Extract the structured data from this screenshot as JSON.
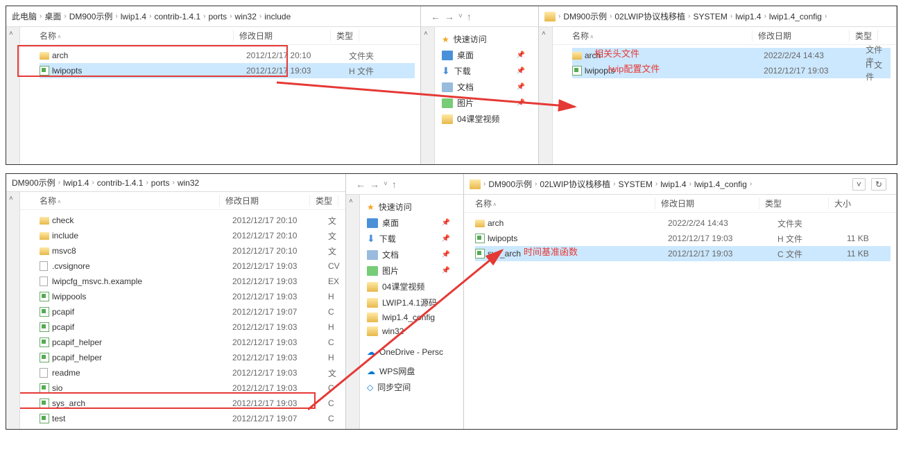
{
  "panel1": {
    "left": {
      "breadcrumb": [
        "此电脑",
        "桌面",
        "DM900示例",
        "lwip1.4",
        "contrib-1.4.1",
        "ports",
        "win32",
        "include"
      ],
      "cols": {
        "name": "名称",
        "date": "修改日期",
        "type": "类型"
      },
      "rows": [
        {
          "icon": "folder",
          "name": "arch",
          "date": "2012/12/17 20:10",
          "type": "文件夹",
          "selected": false
        },
        {
          "icon": "hfile",
          "name": "lwipopts",
          "date": "2012/12/17 19:03",
          "type": "H 文件",
          "selected": true
        }
      ]
    },
    "center": {
      "qa_header": "快速访问",
      "items": [
        {
          "icon": "desktop",
          "label": "桌面",
          "pin": true
        },
        {
          "icon": "download",
          "label": "下载",
          "pin": true
        },
        {
          "icon": "doc",
          "label": "文档",
          "pin": true
        },
        {
          "icon": "pic",
          "label": "图片",
          "pin": true
        },
        {
          "icon": "folder",
          "label": "04课堂视频",
          "pin": false
        }
      ]
    },
    "right": {
      "breadcrumb": [
        "DM900示例",
        "02LWIP协议栈移植",
        "SYSTEM",
        "lwip1.4",
        "lwip1.4_config"
      ],
      "cols": {
        "name": "名称",
        "date": "修改日期",
        "type": "类型"
      },
      "rows": [
        {
          "icon": "folder",
          "name": "arch",
          "date": "2022/2/24 14:43",
          "type": "文件夹",
          "selected": true,
          "note": "相关头文件"
        },
        {
          "icon": "hfile",
          "name": "lwipopts",
          "date": "2012/12/17 19:03",
          "type": "H 文件",
          "selected": true,
          "note": "lwip配置文件"
        }
      ]
    }
  },
  "panel2": {
    "left": {
      "breadcrumb": [
        "DM900示例",
        "lwip1.4",
        "contrib-1.4.1",
        "ports",
        "win32"
      ],
      "cols": {
        "name": "名称",
        "date": "修改日期",
        "type": "类型"
      },
      "rows": [
        {
          "icon": "folder",
          "name": "check",
          "date": "2012/12/17 20:10",
          "type": "文"
        },
        {
          "icon": "folder",
          "name": "include",
          "date": "2012/12/17 20:10",
          "type": "文"
        },
        {
          "icon": "folder",
          "name": "msvc8",
          "date": "2012/12/17 20:10",
          "type": "文"
        },
        {
          "icon": "doc",
          "name": ".cvsignore",
          "date": "2012/12/17 19:03",
          "type": "CV"
        },
        {
          "icon": "doc",
          "name": "lwipcfg_msvc.h.example",
          "date": "2012/12/17 19:03",
          "type": "EX"
        },
        {
          "icon": "hfile",
          "name": "lwippools",
          "date": "2012/12/17 19:03",
          "type": "H"
        },
        {
          "icon": "cfile",
          "name": "pcapif",
          "date": "2012/12/17 19:07",
          "type": "C"
        },
        {
          "icon": "hfile",
          "name": "pcapif",
          "date": "2012/12/17 19:03",
          "type": "H"
        },
        {
          "icon": "cfile",
          "name": "pcapif_helper",
          "date": "2012/12/17 19:03",
          "type": "C"
        },
        {
          "icon": "hfile",
          "name": "pcapif_helper",
          "date": "2012/12/17 19:03",
          "type": "H"
        },
        {
          "icon": "doc",
          "name": "readme",
          "date": "2012/12/17 19:03",
          "type": "文"
        },
        {
          "icon": "cfile",
          "name": "sio",
          "date": "2012/12/17 19:03",
          "type": "C"
        },
        {
          "icon": "cfile",
          "name": "sys_arch",
          "date": "2012/12/17 19:03",
          "type": "C",
          "highlight": true
        },
        {
          "icon": "cfile",
          "name": "test",
          "date": "2012/12/17 19:07",
          "type": "C"
        }
      ]
    },
    "center": {
      "qa_header": "快速访问",
      "items": [
        {
          "icon": "desktop",
          "label": "桌面",
          "pin": true
        },
        {
          "icon": "download",
          "label": "下载",
          "pin": true
        },
        {
          "icon": "doc",
          "label": "文档",
          "pin": true
        },
        {
          "icon": "pic",
          "label": "图片",
          "pin": true
        },
        {
          "icon": "folder",
          "label": "04课堂视频",
          "pin": false
        },
        {
          "icon": "folder",
          "label": "LWIP1.4.1源码",
          "pin": false
        },
        {
          "icon": "folder",
          "label": "lwip1.4_config",
          "pin": false
        },
        {
          "icon": "folder",
          "label": "win32",
          "pin": false
        }
      ],
      "extra": [
        {
          "icon": "cloud",
          "label": "OneDrive - Persc"
        },
        {
          "icon": "wps",
          "label": "WPS网盘"
        },
        {
          "icon": "sync",
          "label": "同步空间"
        }
      ]
    },
    "right": {
      "breadcrumb": [
        "DM900示例",
        "02LWIP协议栈移植",
        "SYSTEM",
        "lwip1.4",
        "lwip1.4_config"
      ],
      "cols": {
        "name": "名称",
        "date": "修改日期",
        "type": "类型",
        "size": "大小"
      },
      "rows": [
        {
          "icon": "folder",
          "name": "arch",
          "date": "2022/2/24 14:43",
          "type": "文件夹",
          "size": ""
        },
        {
          "icon": "hfile",
          "name": "lwipopts",
          "date": "2012/12/17 19:03",
          "type": "H 文件",
          "size": "11 KB"
        },
        {
          "icon": "cfile",
          "name": "sys_arch",
          "date": "2012/12/17 19:03",
          "type": "C 文件",
          "size": "11 KB",
          "selected": true,
          "note": "时间基准函数"
        }
      ]
    }
  }
}
